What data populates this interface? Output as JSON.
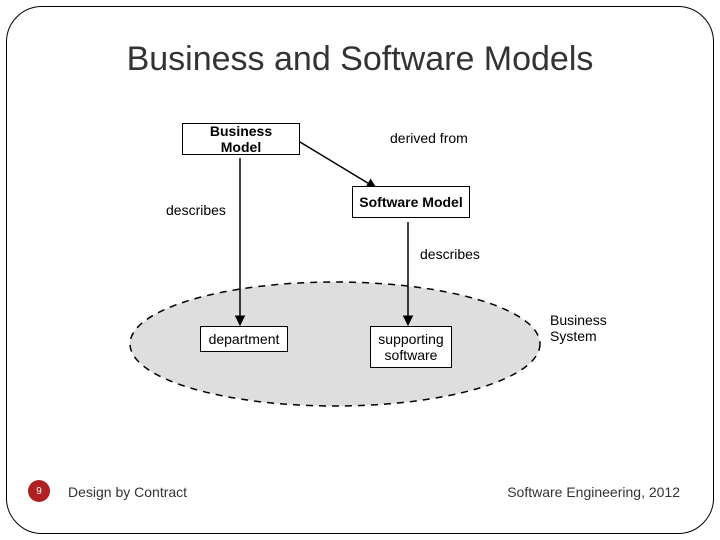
{
  "title": "Business and Software Models",
  "footer": {
    "page_number": "9",
    "left": "Design by Contract",
    "right": "Software Engineering, 2012"
  },
  "diagram": {
    "nodes": {
      "business_model": "Business Model",
      "software_model": "Software Model",
      "department": "department",
      "supporting_software": "supporting\nsoftware",
      "business_system": "Business\nSystem"
    },
    "edges": {
      "derived_from": "derived from",
      "describes_left": "describes",
      "describes_right": "describes"
    }
  }
}
